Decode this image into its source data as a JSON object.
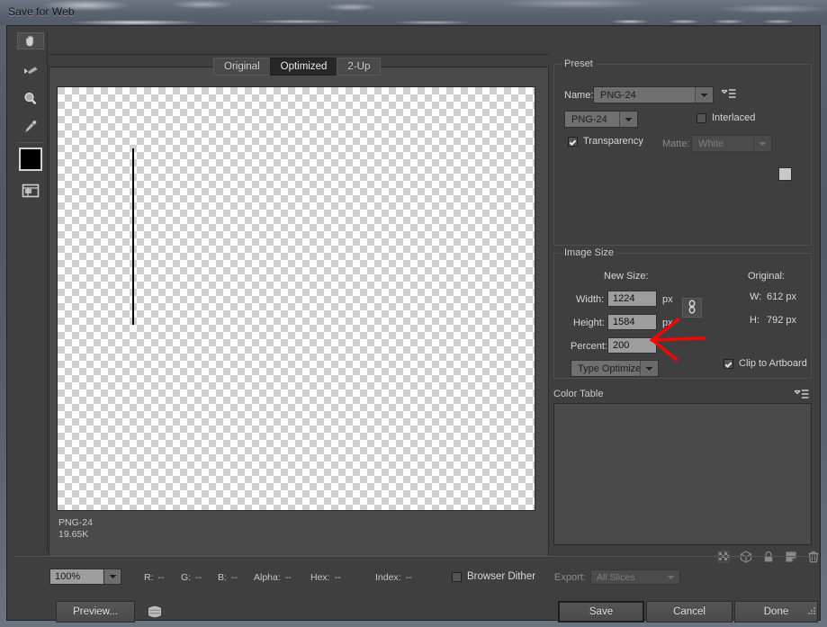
{
  "window": {
    "title": "Save for Web"
  },
  "toolbar": {
    "tools": [
      {
        "name": "hand-tool",
        "selected": true
      },
      {
        "name": "slice-select-tool",
        "selected": false
      },
      {
        "name": "zoom-tool",
        "selected": false
      },
      {
        "name": "eyedropper-tool",
        "selected": false
      }
    ],
    "swatch_color": "#000000",
    "toggle_slices_label": "Toggle Slices Visibility"
  },
  "preview": {
    "tabs": [
      {
        "label": "Original",
        "active": false
      },
      {
        "label": "Optimized",
        "active": true
      },
      {
        "label": "2-Up",
        "active": false
      }
    ],
    "optimized_info": {
      "format": "PNG-24",
      "filesize": "19.65K"
    }
  },
  "preset": {
    "group_label": "Preset",
    "name_label": "Name:",
    "name_value": "PNG-24",
    "format_value": "PNG-24",
    "interlaced_label": "Interlaced",
    "interlaced_checked": false,
    "transparency_label": "Transparency",
    "transparency_checked": true,
    "matte_label": "Matte:",
    "matte_value": "White",
    "matte_swatch": "#c8c8c8"
  },
  "image_size": {
    "group_label": "Image Size",
    "new_size_label": "New Size:",
    "original_label": "Original:",
    "width_label": "Width:",
    "width_value": "1224",
    "width_unit": "px",
    "height_label": "Height:",
    "height_value": "1584",
    "height_unit": "px",
    "percent_label": "Percent:",
    "percent_value": "200",
    "quality_value": "Type Optimized",
    "original_width_label": "W:",
    "original_width_value": "612 px",
    "original_height_label": "H:",
    "original_height_value": "792 px",
    "clip_label": "Clip to Artboard",
    "clip_checked": true,
    "link_constrain": true
  },
  "color_table": {
    "title": "Color Table",
    "entries": []
  },
  "status": {
    "zoom": "100%",
    "channels": [
      {
        "label": "R:",
        "value": "--"
      },
      {
        "label": "G:",
        "value": "--"
      },
      {
        "label": "B:",
        "value": "--"
      },
      {
        "label": "Alpha:",
        "value": "--"
      },
      {
        "label": "Hex:",
        "value": "--"
      },
      {
        "label": "Index:",
        "value": "--"
      }
    ],
    "browser_dither_label": "Browser Dither",
    "browser_dither_checked": false,
    "export_label": "Export:",
    "export_value": "All Slices"
  },
  "buttons": {
    "preview": "Preview...",
    "save": "Save",
    "cancel": "Cancel",
    "done": "Done"
  },
  "annotation": {
    "color": "#fb0303",
    "shape": "left-arrow",
    "points_at": "percent-field"
  },
  "colors": {
    "panel_bg": "#3f3f3f",
    "preview_bg": "#4a4a4a",
    "field_bg": "#9d9d9d",
    "text": "#d6d6d6"
  }
}
